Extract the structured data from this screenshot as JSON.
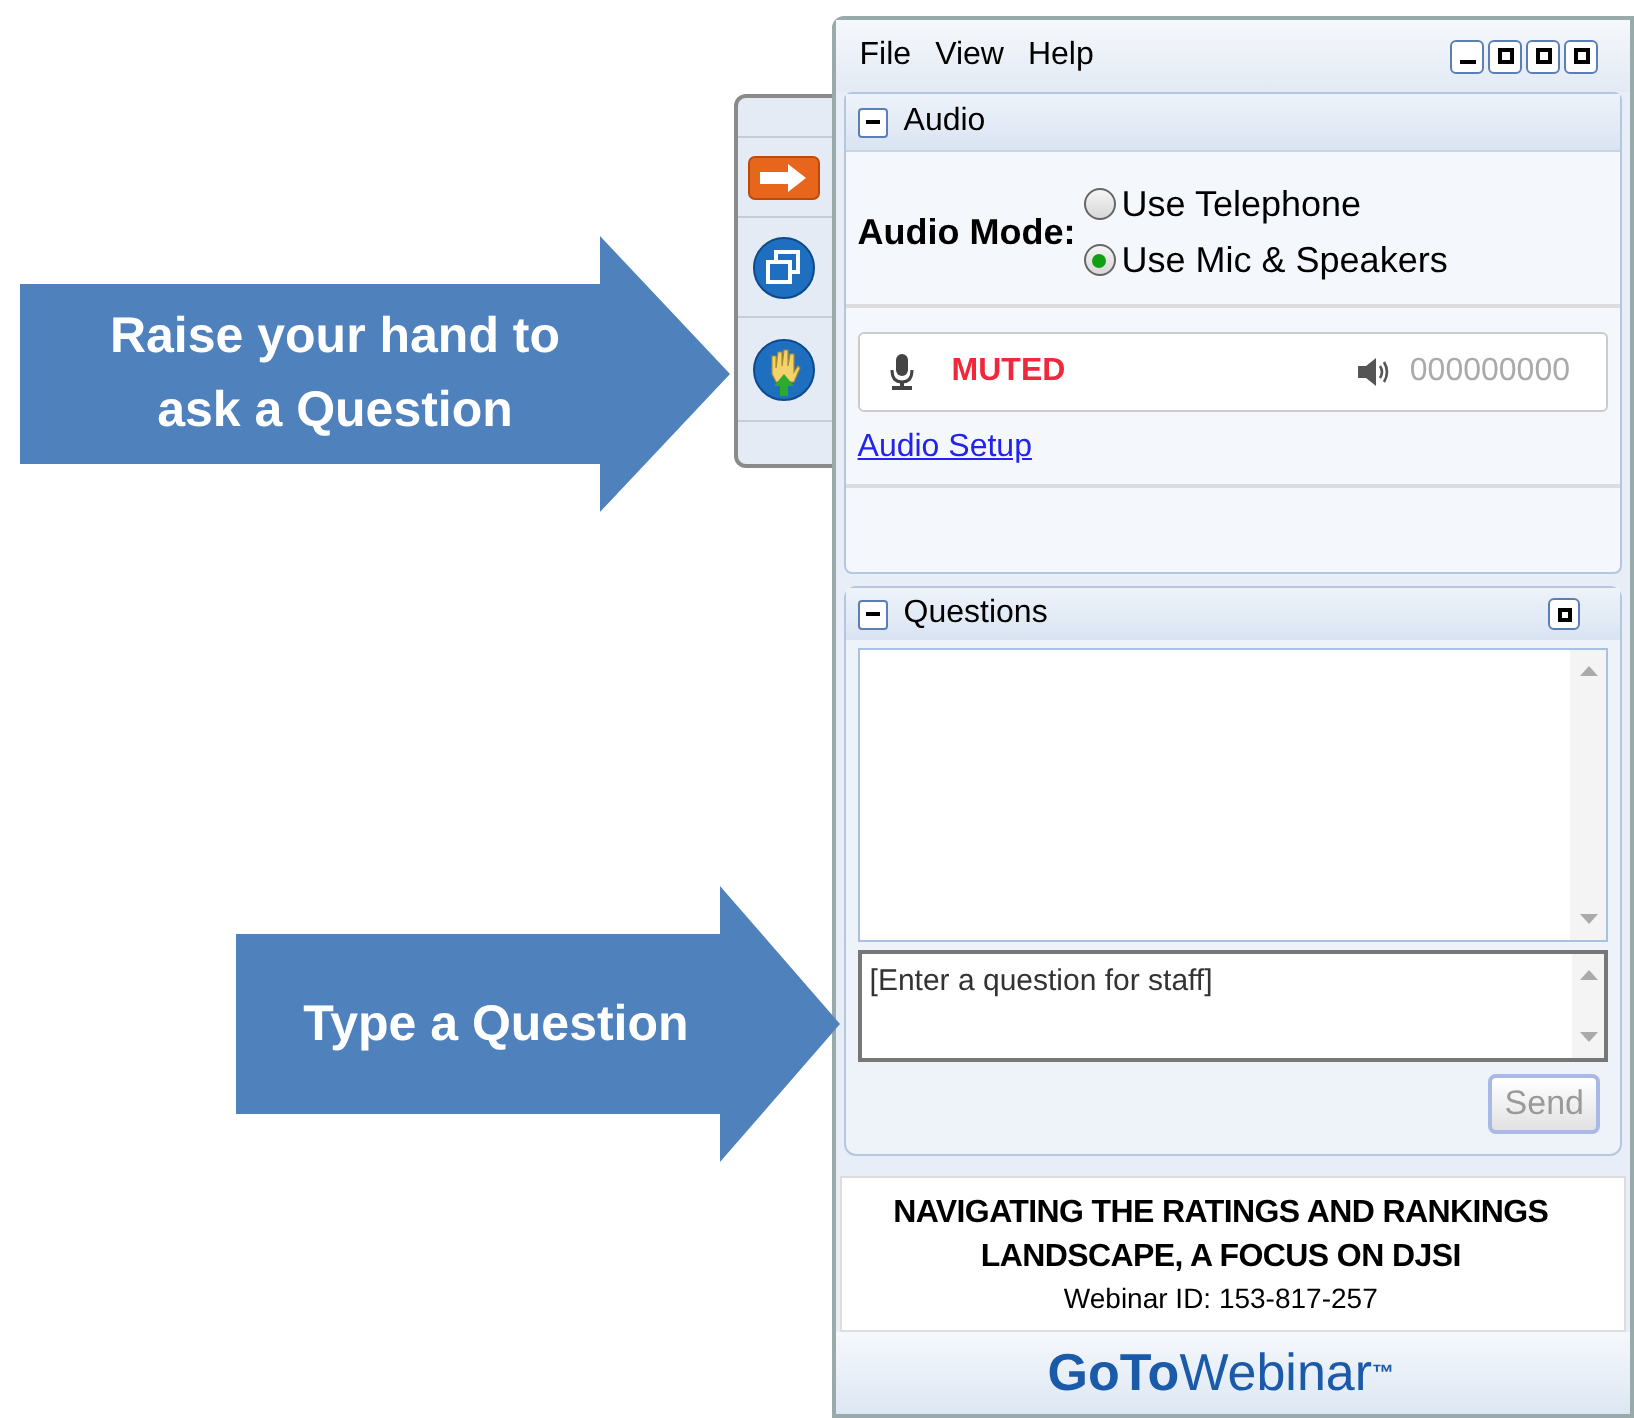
{
  "callouts": [
    {
      "text": "Raise your hand to ask a Question"
    },
    {
      "text": "Type a Question"
    }
  ],
  "menu": [
    "File",
    "View",
    "Help"
  ],
  "audio": {
    "title": "Audio",
    "expanded": true,
    "mode_label": "Audio Mode:",
    "options": [
      {
        "label": "Use Telephone",
        "selected": false
      },
      {
        "label": "Use Mic & Speakers",
        "selected": true
      }
    ],
    "status": "MUTED",
    "speaker_code": "000000000",
    "setup_link": "Audio Setup"
  },
  "questions": {
    "title": "Questions",
    "expanded": true,
    "input": {
      "placeholder": "[Enter a question for staff]"
    },
    "send": "Send"
  },
  "webinar": {
    "title": "NAVIGATING THE RATINGS AND RANKINGS LANDSCAPE, A FOCUS ON DJSI",
    "id": "Webinar ID: 153-817-257"
  },
  "brand": {
    "bold": "GoTo",
    "light": "Webinar",
    "mark": "™"
  }
}
